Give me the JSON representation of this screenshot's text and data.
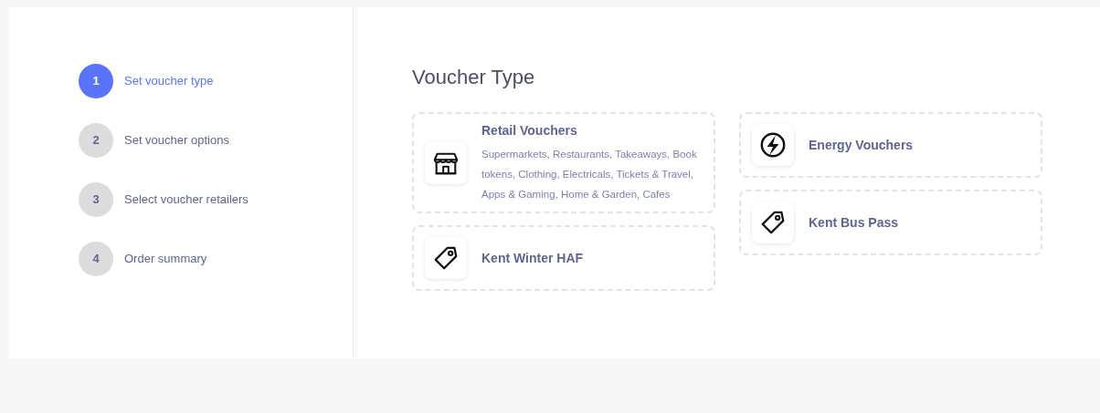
{
  "steps": [
    {
      "number": "1",
      "label": "Set voucher type",
      "selected": true
    },
    {
      "number": "2",
      "label": "Set voucher options",
      "selected": false
    },
    {
      "number": "3",
      "label": "Select voucher retailers",
      "selected": false
    },
    {
      "number": "4",
      "label": "Order summary",
      "selected": false
    }
  ],
  "heading": "Voucher Type",
  "columns": [
    [
      {
        "kind": "store",
        "title": "Retail Vouchers",
        "description": "Supermarkets, Restaurants, Takeaways, Book tokens, Clothing, Electricals, Tickets & Travel, Apps & Gaming, Home & Garden, Cafes"
      },
      {
        "kind": "tag",
        "title": "Kent Winter HAF"
      }
    ],
    [
      {
        "kind": "bolt",
        "title": "Energy Vouchers"
      },
      {
        "kind": "tag",
        "title": "Kent Bus Pass"
      }
    ]
  ]
}
